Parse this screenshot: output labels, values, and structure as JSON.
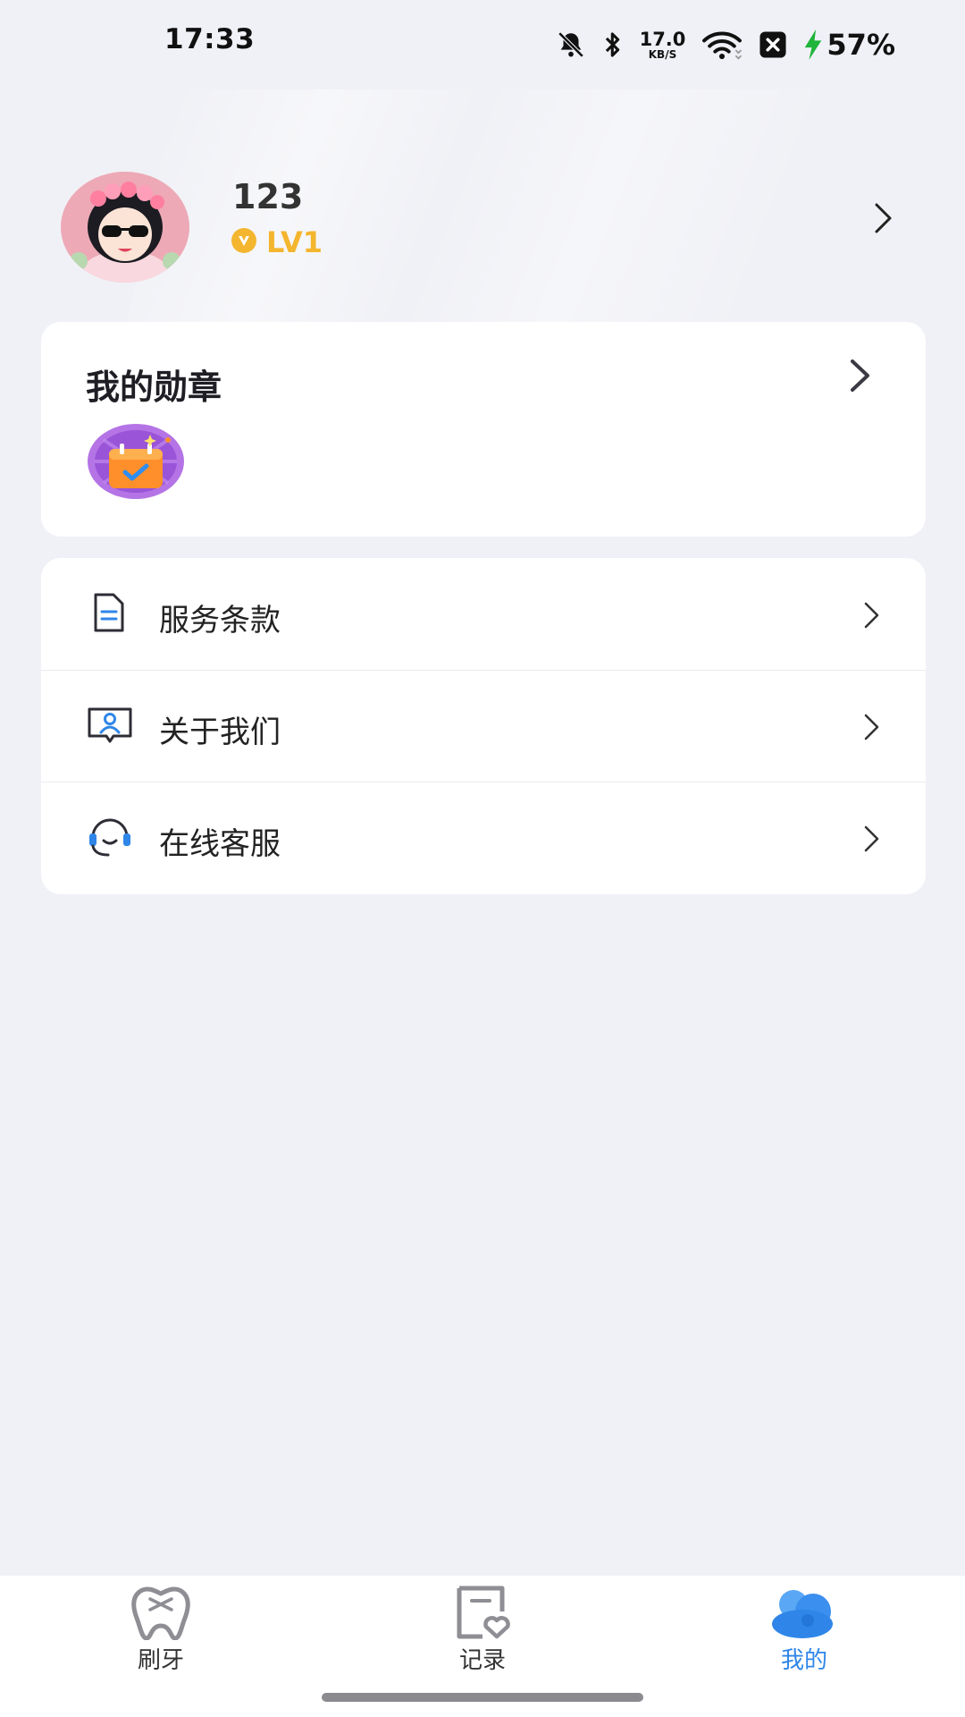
{
  "status_bar": {
    "time": "17:33",
    "net_speed_value": "17.0",
    "net_speed_unit": "KB/S",
    "battery_percent": "57%"
  },
  "profile": {
    "username": "123",
    "level": "LV1"
  },
  "medals": {
    "title": "我的勋章"
  },
  "menu": {
    "items": [
      {
        "label": "服务条款",
        "icon": "document-icon"
      },
      {
        "label": "关于我们",
        "icon": "about-us-icon"
      },
      {
        "label": "在线客服",
        "icon": "headset-icon"
      }
    ]
  },
  "bottom_nav": {
    "items": [
      {
        "label": "刷牙",
        "icon": "tooth-icon",
        "active": false
      },
      {
        "label": "记录",
        "icon": "record-icon",
        "active": false
      },
      {
        "label": "我的",
        "icon": "profile-cloud-icon",
        "active": true
      }
    ]
  },
  "colors": {
    "accent": "#2f86e8",
    "level": "#f4b52f",
    "background": "#f0f1f6"
  }
}
